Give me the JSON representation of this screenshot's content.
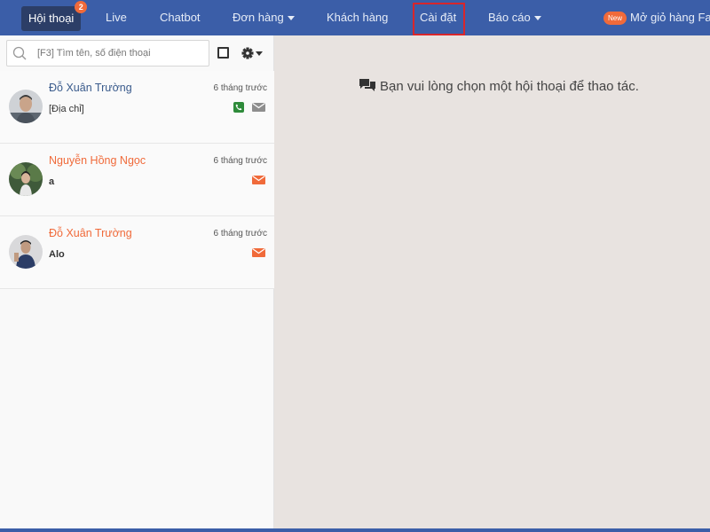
{
  "nav": {
    "conversations": {
      "label": "Hội thoại",
      "badge": "2"
    },
    "live": "Live",
    "chatbot": "Chatbot",
    "orders": "Đơn hàng",
    "customers": "Khách hàng",
    "settings": "Cài đặt",
    "reports": "Báo cáo",
    "new_badge": "New",
    "open_shop": "Mở giỏ hàng Fac"
  },
  "colors": {
    "nav_bg": "#3b5ea8",
    "active_tab_bg": "#2c3e67",
    "accent_orange": "#f06a3a",
    "highlight_red": "#d8262b",
    "name_blue": "#3a5b8c",
    "phone_green": "#2e8b3a"
  },
  "search": {
    "placeholder": "[F3] Tìm tên, số điện thoại"
  },
  "toolbar": {
    "select_all_icon": "checkbox-icon",
    "settings_icon": "gear-icon"
  },
  "conversations": [
    {
      "name": "Đỗ Xuân Trường",
      "time": "6 tháng trước",
      "message": "[Địa chỉ]",
      "unread": false,
      "icons": [
        "phone-icon",
        "mail-icon"
      ]
    },
    {
      "name": "Nguyễn Hồng Ngọc",
      "time": "6 tháng trước",
      "message": "a",
      "unread": true,
      "icons": [
        "mail-icon"
      ]
    },
    {
      "name": "Đỗ Xuân Trường",
      "time": "6 tháng trước",
      "message": "Alo",
      "unread": true,
      "icons": [
        "mail-icon"
      ]
    }
  ],
  "main": {
    "empty_message": "Bạn vui lòng chọn một hội thoại để thao tác.",
    "icon": "chat-bubbles-icon"
  }
}
